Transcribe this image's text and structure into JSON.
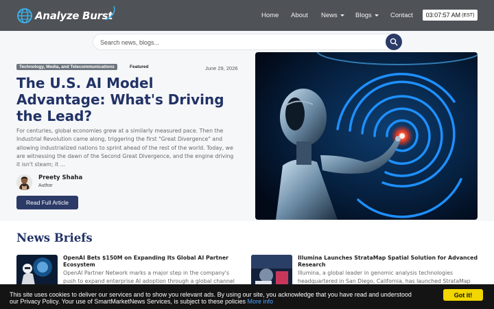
{
  "header": {
    "logo_text": "Analyze Burst",
    "nav": [
      {
        "label": "Home"
      },
      {
        "label": "About"
      },
      {
        "label": "News"
      },
      {
        "label": "Blogs"
      },
      {
        "label": "Contact"
      }
    ],
    "clock_time": "03:07:57 AM",
    "clock_tz": "(EST)"
  },
  "search": {
    "placeholder": "Search news, blogs..."
  },
  "hero": {
    "category": "Technology, Media, and Telecommunications",
    "featured_label": "Featured",
    "date": "June 29, 2026",
    "title": "The U.S. AI Model Advantage: What's Driving the Lead?",
    "excerpt": "For centuries, global economies grew at a similarly measured pace. Then the Industrial Revolution came along, triggering the first \"Great Divergence\" and allowing industrialized nations to sprint ahead of the rest of the world. Today, we are witnessing the dawn of the Second Great Divergence, and the engine driving it isn't steam; it ...",
    "author_name": "Preety Shaha",
    "author_role": "Author",
    "read_label": "Read Full Article"
  },
  "briefs": {
    "title": "News Briefs",
    "items": [
      {
        "title": "OpenAI Bets $150M on Expanding Its Global AI Partner Ecosystem",
        "text": "OpenAI Partner Network marks a major step in the company's push to expand enterprise AI adoption through a global channel"
      },
      {
        "title": "Illumina Launches StrataMap Spatial Solution for Advanced Research",
        "text": "Illumina, a global leader in genomic analysis technologies headquartered in San Diego, California, has launched StrataMap"
      }
    ]
  },
  "cookie": {
    "text": "This site uses cookies to deliver our services and to show you relevant ads. By using our site, you acknowledge that you have read and understood our Privacy Policy. Your use of SmartMarketNews Services, is subject to these policies",
    "link_label": "More info",
    "button_label": "Got it!"
  },
  "colors": {
    "header_bg": "#4f5257",
    "brand_navy": "#213266",
    "button_navy": "#2c3a67",
    "cookie_button": "#f1d600",
    "cookie_link": "#4da3ff"
  }
}
